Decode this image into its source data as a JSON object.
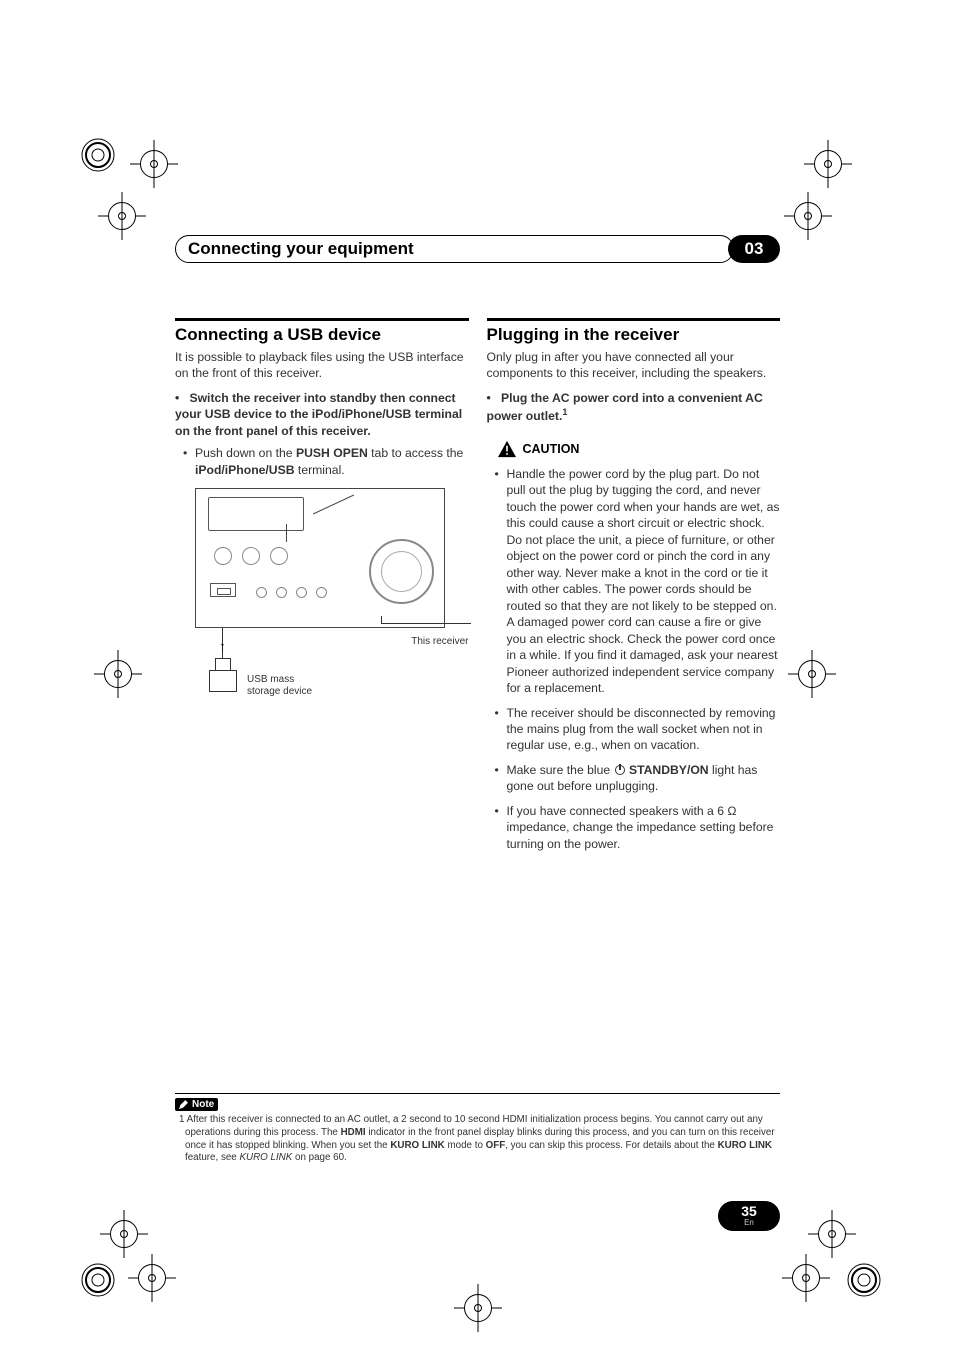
{
  "header": {
    "title": "Connecting your equipment",
    "section_number": "03"
  },
  "left": {
    "heading": "Connecting a USB device",
    "intro": "It is possible to playback files using the USB interface on the front of this receiver.",
    "step_bullet": "•",
    "step_text_1": "Switch the receiver into standby then connect your USB device to the iPod/iPhone/USB terminal on the front panel of this receiver.",
    "sub_text_pre": "Push down on the ",
    "sub_push_open": "PUSH OPEN",
    "sub_text_mid": " tab to access the ",
    "sub_terminal": "iPod/iPhone/USB",
    "sub_text_post": " terminal.",
    "fig_receiver_label": "This receiver",
    "fig_usb_label_1": "USB mass",
    "fig_usb_label_2": "storage device"
  },
  "right": {
    "heading": "Plugging in the receiver",
    "intro": "Only plug in after you have connected all your components to this receiver, including the speakers.",
    "step_bullet": "•",
    "step_text": "Plug the AC power cord into a convenient AC power outlet.",
    "caution_label": "CAUTION",
    "caution_items": [
      "Handle the power cord by the plug part. Do not pull out the plug by tugging the cord, and never touch the power cord when your hands are wet, as this could cause a short circuit or electric shock. Do not place the unit, a piece of furniture, or other object on the power cord or pinch the cord in any other way. Never make a knot in the cord or tie it with other cables. The power cords should be routed so that they are not likely to be stepped on. A damaged power cord can cause a fire or give you an electric shock. Check the power cord once in a while. If you find it damaged, ask your nearest Pioneer authorized independent service company for a replacement.",
      "The receiver should be disconnected by removing the mains plug from the wall socket when not in regular use, e.g., when on vacation."
    ],
    "caution_standby_pre": "Make sure the blue ",
    "caution_standby_bold": "STANDBY/ON",
    "caution_standby_post": " light has gone out before unplugging.",
    "caution_impedance": "If you have connected speakers with a 6 Ω impedance, change the impedance setting before turning on the power."
  },
  "note": {
    "label": "Note",
    "text_pre": "1 After this receiver is connected to an AC outlet, a 2 second to 10 second HDMI initialization process begins. You cannot carry out any operations during this process. The ",
    "hdmi": "HDMI",
    "text_mid1": " indicator in the front panel display blinks during this process, and you can turn on this receiver once it has stopped blinking. When you set the ",
    "kuro1": "KURO LINK",
    "text_mid2": " mode to ",
    "off": "OFF",
    "text_mid3": ", you can skip this process. For details about the ",
    "kuro2": "KURO LINK",
    "text_mid4": " feature, see ",
    "kuro_italic": "KURO LINK",
    "text_end": " on page 60."
  },
  "page_number": "35",
  "page_lang": "En"
}
